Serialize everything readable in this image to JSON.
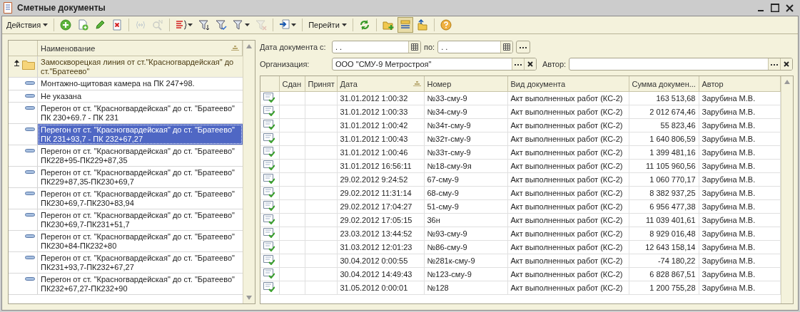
{
  "window": {
    "title": "Сметные документы"
  },
  "toolbar": [
    {
      "kind": "menu",
      "label": "Действия"
    },
    {
      "kind": "separator"
    },
    {
      "kind": "button",
      "disabled": false,
      "pressed": false,
      "dropdown": false
    },
    {
      "kind": "button",
      "disabled": false,
      "pressed": false,
      "dropdown": false
    },
    {
      "kind": "button",
      "disabled": false,
      "pressed": false,
      "dropdown": false
    },
    {
      "kind": "button",
      "disabled": false,
      "pressed": false,
      "dropdown": false
    },
    {
      "kind": "separator"
    },
    {
      "kind": "button",
      "disabled": true,
      "pressed": false,
      "dropdown": false
    },
    {
      "kind": "button",
      "disabled": true,
      "pressed": false,
      "dropdown": false
    },
    {
      "kind": "separator"
    },
    {
      "kind": "button",
      "disabled": false,
      "pressed": false,
      "dropdown": true
    },
    {
      "kind": "button",
      "disabled": false,
      "pressed": false,
      "dropdown": false
    },
    {
      "kind": "button",
      "disabled": false,
      "pressed": false,
      "dropdown": false
    },
    {
      "kind": "button",
      "disabled": false,
      "pressed": false,
      "dropdown": true
    },
    {
      "kind": "button",
      "disabled": true,
      "pressed": false,
      "dropdown": false
    },
    {
      "kind": "separator"
    },
    {
      "kind": "button",
      "disabled": false,
      "pressed": false,
      "dropdown": true
    },
    {
      "kind": "separator"
    },
    {
      "kind": "menu",
      "label": "Перейти"
    },
    {
      "kind": "separator"
    },
    {
      "kind": "button",
      "disabled": false,
      "pressed": false,
      "dropdown": false
    },
    {
      "kind": "separator"
    },
    {
      "kind": "button",
      "disabled": false,
      "pressed": false,
      "dropdown": false
    },
    {
      "kind": "button",
      "disabled": false,
      "pressed": true,
      "dropdown": false
    },
    {
      "kind": "button",
      "disabled": false,
      "pressed": false,
      "dropdown": false
    },
    {
      "kind": "separator"
    },
    {
      "kind": "button",
      "disabled": false,
      "pressed": false,
      "dropdown": false
    }
  ],
  "tree": {
    "column": {
      "label": "Наименование",
      "sorted": true
    },
    "items": [
      {
        "kind": "group",
        "expanded": true,
        "selected": false,
        "label": "Замоскворецкая линия от ст.\"Красногвардейская\" до ст.\"Братеево\""
      },
      {
        "kind": "item",
        "selected": false,
        "label": "Монтажно-щитовая камера на ПК 247+98."
      },
      {
        "kind": "item",
        "selected": false,
        "label": "Не указана"
      },
      {
        "kind": "item",
        "selected": false,
        "label": "Перегон от ст. \"Красногвардейская\" до ст. \"Братеево\" ПК 230+69.7 - ПК 231"
      },
      {
        "kind": "item",
        "selected": true,
        "label": "Перегон от ст. \"Красногвардейская\" до ст. \"Братеево\" ПК 231+93,7 - ПК 232+67,27"
      },
      {
        "kind": "item",
        "selected": false,
        "label": "Перегон от ст. \"Красногвардейская\" до ст. \"Братеево\" ПК228+95-ПК229+87,35"
      },
      {
        "kind": "item",
        "selected": false,
        "label": "Перегон от ст. \"Красногвардейская\" до ст. \"Братеево\" ПК229+87,35-ПК230+69,7"
      },
      {
        "kind": "item",
        "selected": false,
        "label": "Перегон от ст. \"Красногвардейская\" до ст. \"Братеево\" ПК230+69,7-ПК230+83,94"
      },
      {
        "kind": "item",
        "selected": false,
        "label": "Перегон от ст. \"Красногвардейская\" до ст. \"Братеево\" ПК230+69,7-ПК231+51,7"
      },
      {
        "kind": "item",
        "selected": false,
        "label": "Перегон от ст. \"Красногвардейская\" до ст. \"Братеево\" ПК230+84-ПК232+80"
      },
      {
        "kind": "item",
        "selected": false,
        "label": "Перегон от ст. \"Красногвардейская\" до ст. \"Братеево\" ПК231+93,7-ПК232+67,27"
      },
      {
        "kind": "item",
        "selected": false,
        "label": "Перегон от ст. \"Красногвардейская\" до ст. \"Братеево\" ПК232+67,27-ПК232+90"
      }
    ]
  },
  "filters": {
    "date_from": {
      "label": "Дата документа с:",
      "value": ". ."
    },
    "date_to": {
      "label": "по:",
      "value": ". ."
    },
    "organization": {
      "label": "Организация:",
      "value": "ООО \"СМУ-9 Метростроя\""
    },
    "author": {
      "label": "Автор:"
    }
  },
  "table": {
    "columns": [
      {
        "label": "Сдан"
      },
      {
        "label": "Принят"
      },
      {
        "label": "Дата",
        "sorted": true
      },
      {
        "label": "Номер"
      },
      {
        "label": "Вид документа"
      },
      {
        "label": "Сумма докумен..."
      },
      {
        "label": "Автор"
      }
    ],
    "rows": [
      {
        "date": "31.01.2012 1:00:32",
        "number": "№33-сму-9",
        "type": "Акт выполненных работ (КС-2)",
        "sum": "163 513,68",
        "author": "Зарубина М.В."
      },
      {
        "date": "31.01.2012 1:00:33",
        "number": "№34-сму-9",
        "type": "Акт выполненных работ (КС-2)",
        "sum": "2 012 674,46",
        "author": "Зарубина М.В."
      },
      {
        "date": "31.01.2012 1:00:42",
        "number": "№34т-сму-9",
        "type": "Акт выполненных работ (КС-2)",
        "sum": "55 823,46",
        "author": "Зарубина М.В."
      },
      {
        "date": "31.01.2012 1:00:43",
        "number": "№32т-сму-9",
        "type": "Акт выполненных работ (КС-2)",
        "sum": "1 640 806,59",
        "author": "Зарубина М.В."
      },
      {
        "date": "31.01.2012 1:00:46",
        "number": "№33т-сму-9",
        "type": "Акт выполненных работ (КС-2)",
        "sum": "1 399 481,16",
        "author": "Зарубина М.В."
      },
      {
        "date": "31.01.2012 16:56:11",
        "number": "№18-сму-9я",
        "type": "Акт выполненных работ (КС-2)",
        "sum": "11 105 960,56",
        "author": "Зарубина М.В."
      },
      {
        "date": "29.02.2012 9:24:52",
        "number": "67-сму-9",
        "type": "Акт выполненных работ (КС-2)",
        "sum": "1 060 770,17",
        "author": "Зарубина М.В."
      },
      {
        "date": "29.02.2012 11:31:14",
        "number": "68-сму-9",
        "type": "Акт выполненных работ (КС-2)",
        "sum": "8 382 937,25",
        "author": "Зарубина М.В."
      },
      {
        "date": "29.02.2012 17:04:27",
        "number": "51-сму-9",
        "type": "Акт выполненных работ (КС-2)",
        "sum": "6 956 477,38",
        "author": "Зарубина М.В."
      },
      {
        "date": "29.02.2012 17:05:15",
        "number": "36н",
        "type": "Акт выполненных работ (КС-2)",
        "sum": "11 039 401,61",
        "author": "Зарубина М.В."
      },
      {
        "date": "23.03.2012 13:44:52",
        "number": "№93-сму-9",
        "type": "Акт выполненных работ (КС-2)",
        "sum": "8 929 016,48",
        "author": "Зарубина М.В."
      },
      {
        "date": "31.03.2012 12:01:23",
        "number": "№86-сму-9",
        "type": "Акт выполненных работ (КС-2)",
        "sum": "12 643 158,14",
        "author": "Зарубина М.В."
      },
      {
        "date": "30.04.2012 0:00:55",
        "number": "№281к-сму-9",
        "type": "Акт выполненных работ (КС-2)",
        "sum": "-74 180,22",
        "author": "Зарубина М.В."
      },
      {
        "date": "30.04.2012 14:49:43",
        "number": "№123-сму-9",
        "type": "Акт выполненных работ (КС-2)",
        "sum": "6 828 867,51",
        "author": "Зарубина М.В."
      },
      {
        "date": "31.05.2012 0:00:01",
        "number": "№128",
        "type": "Акт выполненных работ (КС-2)",
        "sum": "1 200 755,28",
        "author": "Зарубина М.В."
      }
    ]
  }
}
